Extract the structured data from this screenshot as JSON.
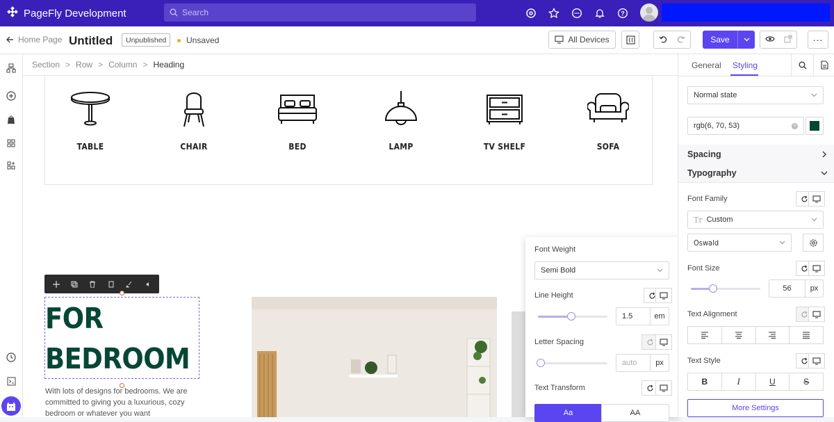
{
  "app": {
    "title": "PageFly Development"
  },
  "search": {
    "placeholder": "Search"
  },
  "toolbar": {
    "back_label": "Home Page",
    "page_title": "Untitled",
    "publish_badge": "Unpublished",
    "save_status": "Unsaved",
    "devices_label": "All Devices",
    "save_label": "Save"
  },
  "breadcrumb": [
    "Section",
    "Row",
    "Column",
    "Heading"
  ],
  "categories": [
    {
      "label": "TABLE",
      "icon": "table-icon"
    },
    {
      "label": "CHAIR",
      "icon": "chair-icon"
    },
    {
      "label": "BED",
      "icon": "bed-icon"
    },
    {
      "label": "LAMP",
      "icon": "lamp-icon"
    },
    {
      "label": "TV SHELF",
      "icon": "tv-shelf-icon"
    },
    {
      "label": "SOFA",
      "icon": "sofa-icon"
    }
  ],
  "content": {
    "heading_line1": "FOR",
    "heading_line2": "BEDROOM",
    "body": "With lots of designs for bedrooms. We are committed to giving you a luxurious, cozy bedroom or whatever you want"
  },
  "popover": {
    "font_weight_label": "Font Weight",
    "font_weight_value": "Semi Bold",
    "line_height_label": "Line Height",
    "line_height_value": "1.5",
    "line_height_unit": "em",
    "letter_spacing_label": "Letter Spacing",
    "letter_spacing_placeholder": "auto",
    "letter_spacing_unit": "px",
    "text_transform_label": "Text Transform",
    "transform_options": [
      "Aa",
      "AA"
    ]
  },
  "panel": {
    "tabs": [
      "General",
      "Styling"
    ],
    "state_value": "Normal state",
    "color_value": "rgb(6, 70, 53)",
    "color_swatch": "#064635",
    "spacing_label": "Spacing",
    "typography_label": "Typography",
    "font_family_label": "Font Family",
    "font_family_type": "Custom",
    "font_family_value": "Oswald",
    "font_size_label": "Font Size",
    "font_size_value": "56",
    "font_size_unit": "px",
    "text_alignment_label": "Text Alignment",
    "text_style_label": "Text Style",
    "more_settings_label": "More Settings"
  },
  "colors": {
    "topbar": "#3a1fb8",
    "accent": "#5b45f0",
    "heading": "#064635"
  }
}
